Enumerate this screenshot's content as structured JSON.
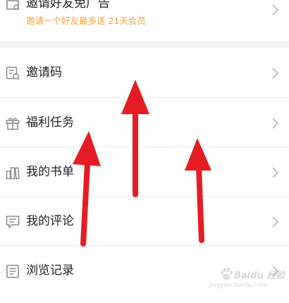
{
  "invite_friends": {
    "title": "邀请好友免广告",
    "subtitle": "邀请一个好友最多送 21天会员",
    "icon": "invite-ticket-icon"
  },
  "menu": {
    "items": [
      {
        "label": "邀请码",
        "icon": "invite-code-icon"
      },
      {
        "label": "福利任务",
        "icon": "gift-icon"
      },
      {
        "label": "我的书单",
        "icon": "booklist-icon"
      },
      {
        "label": "我的评论",
        "icon": "comment-icon"
      },
      {
        "label": "浏览记录",
        "icon": "history-icon"
      }
    ]
  },
  "colors": {
    "subtitle": "#f0a33c",
    "text": "#222222",
    "icon": "#8a8a8a",
    "chevron": "#bdbdbd",
    "arrow": "#e51c23",
    "divider": "#f4f4f4"
  },
  "watermark": {
    "text": "Baidu 经验",
    "url": "jingyan.baidu.com"
  }
}
